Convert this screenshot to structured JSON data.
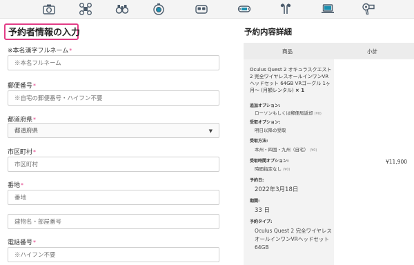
{
  "icon_bar": {
    "icons": [
      "camera-icon",
      "drone-icon",
      "binoculars-icon",
      "action-camera-icon",
      "vr-headset-icon",
      "game-controller-icon",
      "earphones-icon",
      "laptop-icon",
      "hair-dryer-icon"
    ]
  },
  "form": {
    "title": "予約者情報の入力",
    "required_mark": "*",
    "fields": [
      {
        "label": "※本名漢字フルネーム",
        "placeholder": "※本名フルネーム"
      },
      {
        "label": "郵便番号",
        "placeholder": "※自宅の郵便番号・ハイフン不要"
      },
      {
        "label": "都道府県",
        "value": "都道府県"
      },
      {
        "label": "市区町村",
        "placeholder": "市区町村"
      },
      {
        "label": "番地",
        "placeholder": "番地"
      },
      {
        "label": "",
        "placeholder": "建物名・部屋番号"
      },
      {
        "label": "電話番号",
        "placeholder": "※ハイフン不要"
      }
    ]
  },
  "summary": {
    "title": "予約内容詳細",
    "col_product": "商品",
    "col_subtotal": "小計",
    "product_name": "Oculus Quest 2 オキュラスクエスト2 完全ワイヤレスオールインワンVRヘッドセット 64GB VRゴーグル 1ヶ月〜 (月額レンタル)",
    "quantity": "× 1",
    "subtotal": "¥11,900",
    "options": [
      {
        "label": "追加オプション:",
        "value": "ローソンもしくは郵便局返却",
        "price": "(¥0)"
      },
      {
        "label": "受取オプション:",
        "value": "明日以降の受取",
        "price": ""
      },
      {
        "label": "受取方法:",
        "value": "本州・四国・九州（自宅）",
        "price": "(¥0)"
      },
      {
        "label": "受取時間オプション:",
        "value": "時間指定なし",
        "price": "(¥0)"
      }
    ],
    "reservation_date_label": "予約日:",
    "reservation_date": "2022年3月18日",
    "period_label": "期間:",
    "period": "33 日",
    "type_label": "予約タイプ:",
    "type_value": "Oculus Quest 2 完全ワイヤレスオールインワンVRヘッドセット 64GB"
  }
}
